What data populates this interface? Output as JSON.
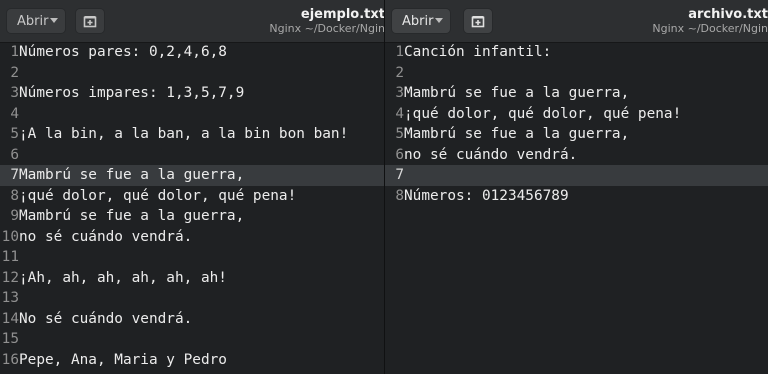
{
  "left": {
    "open_label": "Abrir",
    "title": "ejemplo.txt",
    "path": "Nginx ~/Docker/Ngin",
    "lines": [
      {
        "n": "1",
        "text": "Números pares: 0,2,4,6,8"
      },
      {
        "n": "2",
        "text": ""
      },
      {
        "n": "3",
        "text": "Números impares: 1,3,5,7,9"
      },
      {
        "n": "4",
        "text": ""
      },
      {
        "n": "5",
        "text": "¡A la bin, a la ban, a la bin bon ban!"
      },
      {
        "n": "6",
        "text": ""
      },
      {
        "n": "7",
        "text": "Mambrú se fue a la guerra,"
      },
      {
        "n": "8",
        "text": "¡qué dolor, qué dolor, qué pena!"
      },
      {
        "n": "9",
        "text": "Mambrú se fue a la guerra,"
      },
      {
        "n": "10",
        "text": "no sé cuándo vendrá."
      },
      {
        "n": "11",
        "text": ""
      },
      {
        "n": "12",
        "text": "¡Ah, ah, ah, ah, ah, ah!"
      },
      {
        "n": "13",
        "text": ""
      },
      {
        "n": "14",
        "text": "No sé cuándo vendrá."
      },
      {
        "n": "15",
        "text": ""
      },
      {
        "n": "16",
        "text": "Pepe, Ana, Maria y Pedro"
      }
    ]
  },
  "right": {
    "open_label": "Abrir",
    "title": "archivo.txt",
    "path": "Nginx ~/Docker/Ngin",
    "lines": [
      {
        "n": "1",
        "text": "Canción infantil:"
      },
      {
        "n": "2",
        "text": ""
      },
      {
        "n": "3",
        "text": "Mambrú se fue a la guerra,"
      },
      {
        "n": "4",
        "text": "¡qué dolor, qué dolor, qué pena!"
      },
      {
        "n": "5",
        "text": "Mambrú se fue a la guerra,"
      },
      {
        "n": "6",
        "text": "no sé cuándo vendrá."
      },
      {
        "n": "7",
        "text": ""
      },
      {
        "n": "8",
        "text": "Números: 0123456789"
      }
    ]
  }
}
